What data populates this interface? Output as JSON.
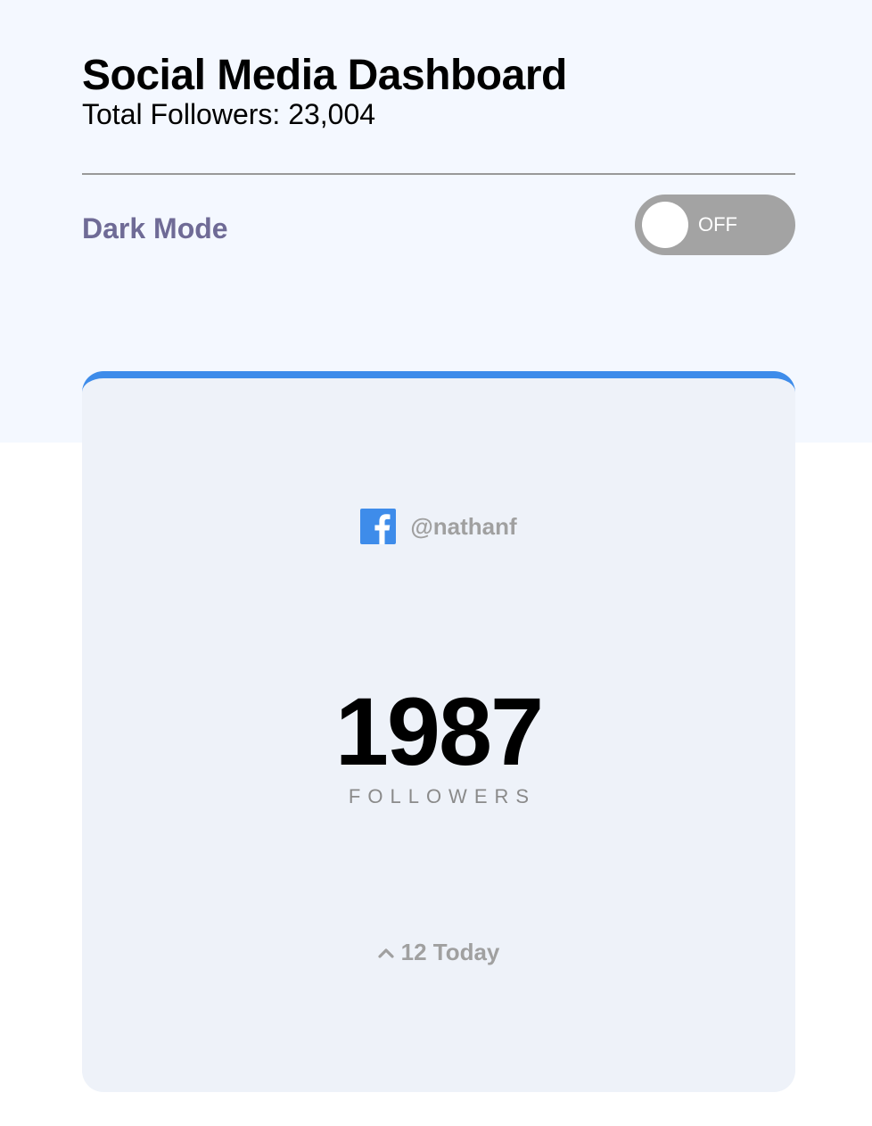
{
  "header": {
    "title": "Social Media Dashboard",
    "total_followers": "Total Followers: 23,004"
  },
  "dark_mode": {
    "label": "Dark Mode",
    "toggle_state": "OFF"
  },
  "card": {
    "platform_icon": "facebook-icon",
    "handle": "@nathanf",
    "count": "1987",
    "count_label": "FOLLOWERS",
    "today": "12 Today",
    "today_icon": "caret-up-icon"
  },
  "colors": {
    "accent": "#3e8cea",
    "dark_mode_label": "#6f6b96",
    "toggle_bg": "#a3a3a3",
    "card_bg": "#eef2f9",
    "top_band": "#f4f8ff"
  }
}
